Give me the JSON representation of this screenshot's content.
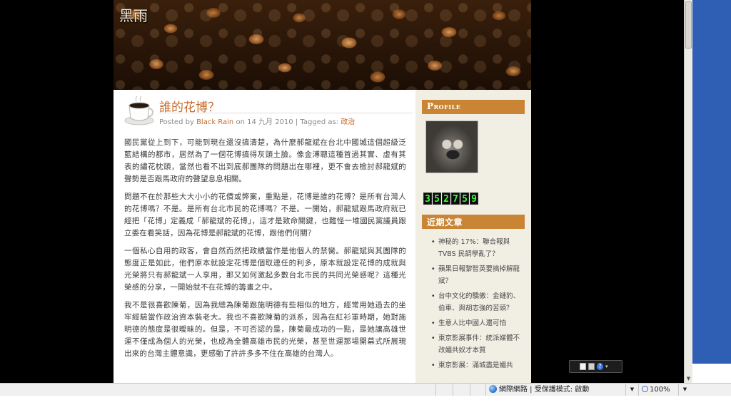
{
  "blog": {
    "title": "黑雨"
  },
  "post": {
    "title": "誰的花博？",
    "meta": {
      "posted_by_label": "Posted by",
      "author": "Black Rain",
      "on_label": "on",
      "date": "14 九月 2010",
      "sep": "|",
      "tagged_label": "Tagged as:",
      "tag": "政治"
    },
    "paragraphs": [
      "國民黨從上到下，可能到現在還沒搞清楚，為什麼郝龍斌在台北中國城這個超級泛藍結構的都市，居然為了一個花博搞得灰頭土臉。像金溥聰這種首過其實、虛有其表的繡花枕頭，當然也看不出到底郝團隊的問題出在哪裡，更不會去檢討郝龍斌的聲勢是否跟馬政府的聲望息息相關。",
      "問題不在於那些大大小小的花價或弊案，重點是，花博是誰的花博？是所有台灣人的花博嗎？不是。是所有台北市民的花博嗎？不是。一開始，郝龍斌跟馬政府就已經把「花博」定義成「郝龍斌的花博」，這才是致命關鍵，也難怪一堆國民黨議員跟立委在看笑話，因為花博是郝龍斌的花博，跟他們何關？",
      "一個私心自用的政客，會自然而然把政績當作是他個人的禁臠。郝龍斌與其團隊的態度正是如此，他們原本就設定花博是個取連任的利多，原本就設定花博的成就與光榮將只有郝龍斌一人享用，那又如何激起多數台北市民的共同光榮感呢？這種光榮感的分享，一開始就不在花博的籌畫之中。",
      "我不是很喜歡陳菊，因為我總為陳菊跟施明德有些相似的地方，經常用她過去的坐牢經驗當作政治資本裝老大。我也不喜歡陳菊的派系，因為在紅衫軍時期，她對施明德的態度是很曖昧的。但是，不可否認的是，陳菊最成功的一點，是她讓高雄世運不僅成為個人的光榮，也成為全體高雄市民的光榮，甚至世運那場開幕式所展現出來的台灣主體意識，更感動了許許多多不住在高雄的台灣人。"
    ]
  },
  "sidebar": {
    "profile_heading": "Profile",
    "counter_digits": [
      "3",
      "5",
      "2",
      "7",
      "5",
      "9"
    ],
    "recent_heading": "近期文章",
    "recent_posts": [
      "神秘的 17%：聯合報與 TVBS 民調學亂了？",
      "蘋果日報黎智英要搞掉解龍斌？",
      "台中文化的驕傲：金鏈豹、伯車、與胡志強的苦頭？",
      "生意人比中國人還可怕",
      "東京影展事件：統派媒體不改媚共奴才本質",
      "東京影展：滿城盡是媚共"
    ]
  },
  "statusbar": {
    "zone_text": "網際網路 | 受保護模式: 啟動",
    "zoom": "100%"
  },
  "icons": {
    "cup": "coffee-cup-icon",
    "globe": "globe-icon",
    "zoom": "magnifier-icon"
  }
}
